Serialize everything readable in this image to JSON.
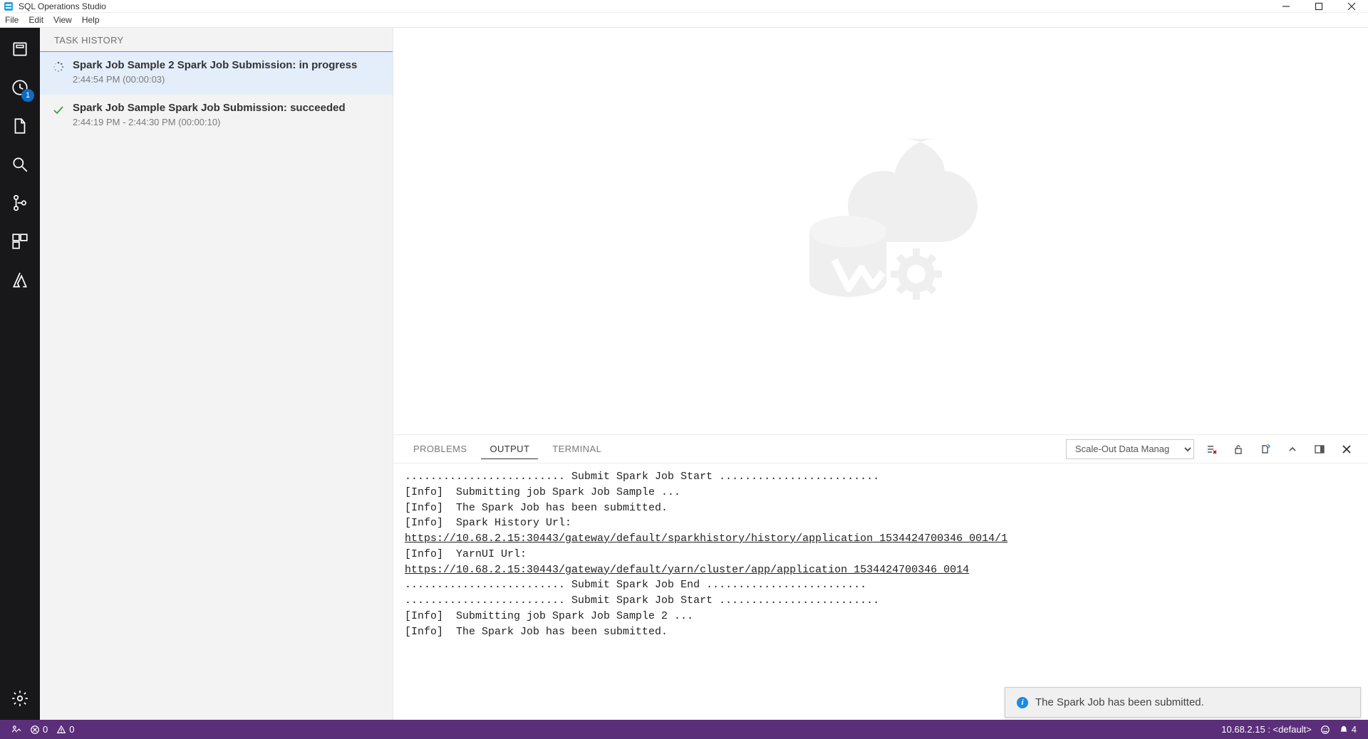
{
  "titlebar": {
    "app_title": "SQL Operations Studio"
  },
  "menu": {
    "items": [
      "File",
      "Edit",
      "View",
      "Help"
    ]
  },
  "activitybar": {
    "items": [
      {
        "name": "servers-icon"
      },
      {
        "name": "task-history-icon",
        "badge": "1"
      },
      {
        "name": "explorer-icon"
      },
      {
        "name": "search-icon"
      },
      {
        "name": "source-control-icon"
      },
      {
        "name": "extensions-icon"
      },
      {
        "name": "azure-icon"
      }
    ],
    "settings_name": "settings-icon"
  },
  "sidepanel": {
    "header": "TASK HISTORY",
    "tasks": [
      {
        "status": "in-progress",
        "icon": "spinner-icon",
        "title": "Spark Job Sample 2 Spark Job Submission: in progress",
        "time": "2:44:54 PM (00:00:03)"
      },
      {
        "status": "succeeded",
        "icon": "checkmark-icon",
        "title": "Spark Job Sample Spark Job Submission: succeeded",
        "time": "2:44:19 PM - 2:44:30 PM (00:00:10)"
      }
    ]
  },
  "panel": {
    "tabs": [
      {
        "label": "PROBLEMS",
        "active": false
      },
      {
        "label": "OUTPUT",
        "active": true
      },
      {
        "label": "TERMINAL",
        "active": false
      }
    ],
    "output_channel_selected": "Scale-Out Data Manag",
    "output_channel_options": [
      "Scale-Out Data Manag"
    ],
    "actions": [
      {
        "name": "clear-output-icon"
      },
      {
        "name": "toggle-lock-icon"
      },
      {
        "name": "open-file-icon"
      },
      {
        "name": "collapse-icon"
      },
      {
        "name": "panel-position-icon"
      },
      {
        "name": "close-panel-icon"
      }
    ],
    "output_lines": [
      "......................... Submit Spark Job Start .........................",
      "[Info]  Submitting job Spark Job Sample ...",
      "[Info]  The Spark Job has been submitted.",
      "[Info]  Spark History Url:",
      {
        "link": "https://10.68.2.15:30443/gateway/default/sparkhistory/history/application_1534424700346_0014/1"
      },
      "[Info]  YarnUI Url:",
      {
        "link": "https://10.68.2.15:30443/gateway/default/yarn/cluster/app/application_1534424700346_0014"
      },
      "......................... Submit Spark Job End .........................",
      "......................... Submit Spark Job Start .........................",
      "[Info]  Submitting job Spark Job Sample 2 ...",
      "[Info]  The Spark Job has been submitted."
    ]
  },
  "toast": {
    "text": "The Spark Job has been submitted."
  },
  "statusbar": {
    "remote_label": "",
    "errors": "0",
    "warnings": "0",
    "connection": "10.68.2.15 : <default>",
    "notifications": "4"
  }
}
